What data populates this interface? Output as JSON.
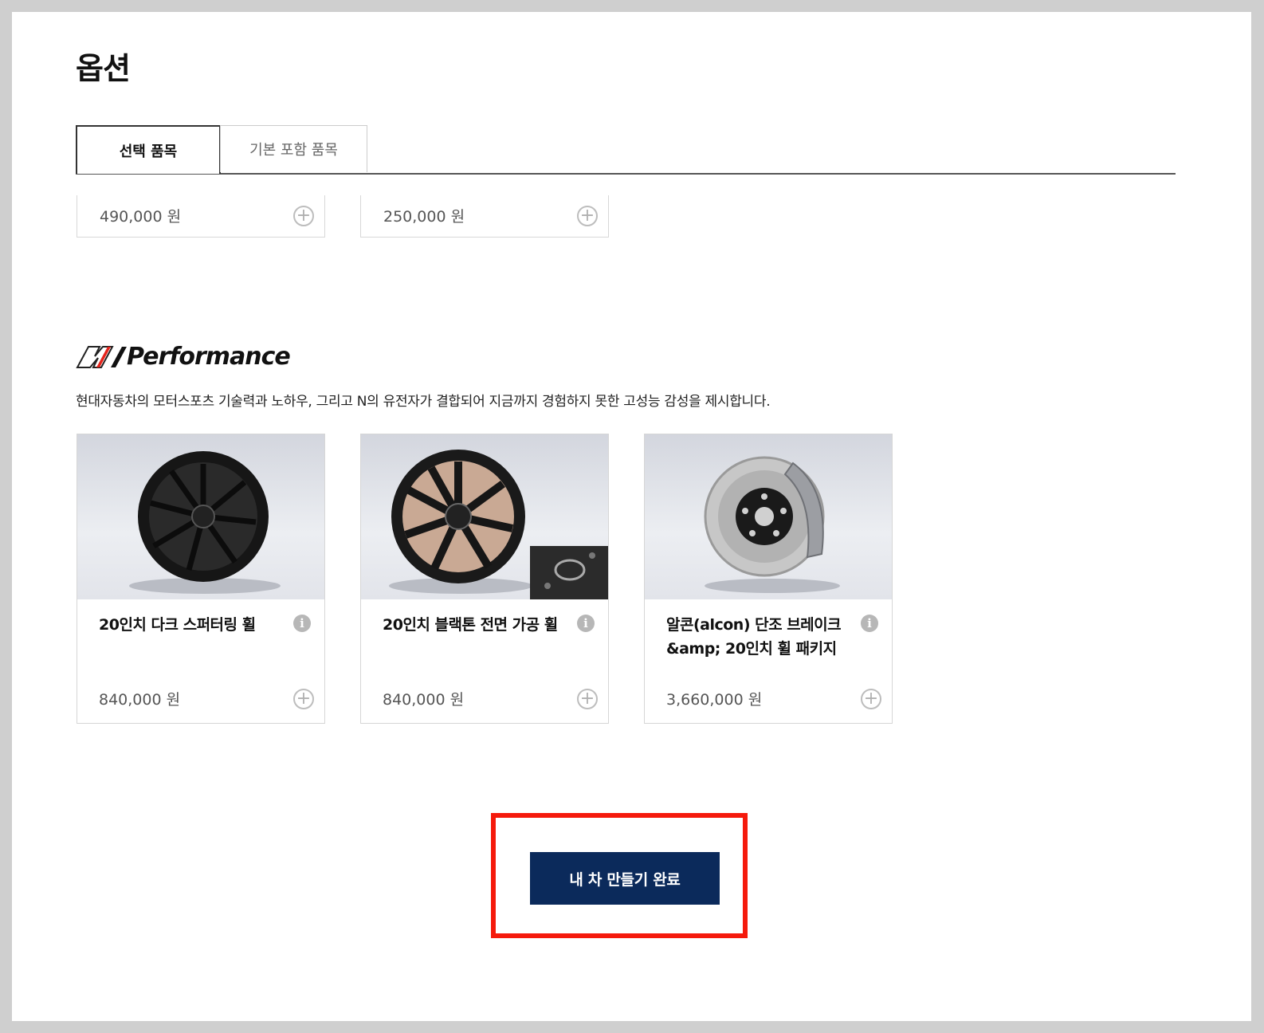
{
  "page_title": "옵션",
  "tabs": [
    {
      "label": "선택 품목",
      "active": true
    },
    {
      "label": "기본 포함 품목",
      "active": false
    }
  ],
  "partial_cards": [
    {
      "price": "490,000 원"
    },
    {
      "price": "250,000 원"
    }
  ],
  "section": {
    "brand_word": "Performance",
    "description": "현대자동차의 모터스포츠 기술력과 노하우, 그리고 N의 유전자가 결합되어 지금까지 경험하지 못한 고성능 감성을 제시합니다."
  },
  "cards": [
    {
      "name": "20인치 다크 스퍼터링 휠",
      "price": "840,000 원",
      "image": "dark-sputtering-wheel"
    },
    {
      "name": "20인치 블랙톤 전면 가공 휠",
      "price": "840,000 원",
      "image": "black-tone-machined-wheel"
    },
    {
      "name": "알콘(alcon) 단조 브레이크 &amp; 20인치 휠 패키지",
      "price": "3,660,000 원",
      "image": "alcon-brake-disc"
    }
  ],
  "cta": {
    "label": "내 차 만들기 완료"
  },
  "colors": {
    "cta_background": "#0b2a5b",
    "highlight": "#f51a0c",
    "frame": "#cfcfcf"
  }
}
